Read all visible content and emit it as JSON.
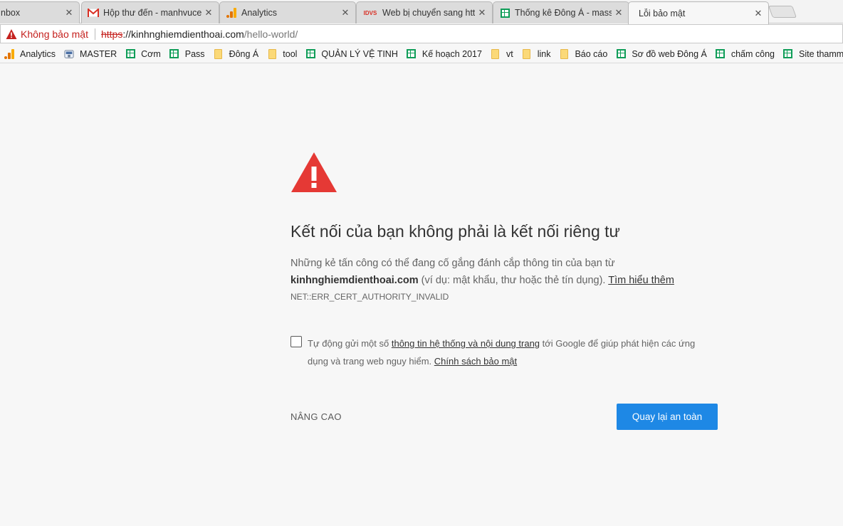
{
  "tabs": [
    {
      "title": "nbox",
      "icon": "inbox-icon",
      "close": "✕"
    },
    {
      "title": "Hộp thư đến - manhvuce",
      "icon": "gmail-icon",
      "close": "✕"
    },
    {
      "title": "Analytics",
      "icon": "analytics-icon",
      "close": "✕"
    },
    {
      "title": "Web bị chuyển sang http",
      "icon": "idvs-icon",
      "icon_text": "IDVS",
      "close": "✕"
    },
    {
      "title": "Thống kê Đông Á - mass",
      "icon": "sheets-icon",
      "close": "✕"
    },
    {
      "title": "Lỗi bảo mật",
      "icon": "none",
      "close": "✕"
    }
  ],
  "omnibox": {
    "security_label": "Không bảo mật",
    "url_scheme": "https",
    "url_host": "://kinhnghiemdienthoai.com",
    "url_path": "/hello-world/"
  },
  "bookmarks": [
    {
      "label": "Analytics",
      "icon": "analytics-icon"
    },
    {
      "label": "MASTER",
      "icon": "master-icon"
    },
    {
      "label": "Cơm",
      "icon": "sheets-icon"
    },
    {
      "label": "Pass",
      "icon": "sheets-icon"
    },
    {
      "label": "Đông Á",
      "icon": "folder-icon"
    },
    {
      "label": "tool",
      "icon": "folder-icon"
    },
    {
      "label": "QUẢN LÝ VỆ TINH",
      "icon": "sheets-icon"
    },
    {
      "label": "Kế hoạch 2017",
      "icon": "sheets-icon"
    },
    {
      "label": "vt",
      "icon": "folder-icon"
    },
    {
      "label": "link",
      "icon": "folder-icon"
    },
    {
      "label": "Báo cáo",
      "icon": "folder-icon"
    },
    {
      "label": "Sơ đồ web Đông Á",
      "icon": "sheets-icon"
    },
    {
      "label": "chấm công",
      "icon": "sheets-icon"
    },
    {
      "label": "Site thammyvi",
      "icon": "sheets-icon"
    }
  ],
  "interstitial": {
    "heading": "Kết nối của bạn không phải là kết nối riêng tư",
    "explain_1": "Những kẻ tấn công có thể đang cố gắng đánh cắp thông tin của bạn từ",
    "explain_host": "kinhnghiemdienthoai.com",
    "explain_2": " (ví dụ: mật khẩu, thư hoặc thẻ tín dụng). ",
    "learn_more": "Tìm hiểu thêm",
    "error_code": "NET::ERR_CERT_AUTHORITY_INVALID",
    "report_1": "Tự động gửi một số ",
    "report_link": "thông tin hệ thống và nội dung trang",
    "report_2": " tới Google để giúp phát hiện các ứng dụng và trang web nguy hiểm. ",
    "privacy_link": "Chính sách bảo mật",
    "advanced": "NÂNG CAO",
    "back_button": "Quay lại an toàn"
  },
  "colors": {
    "danger": "#c5221f",
    "warning_triangle": "#e53935",
    "primary_button": "#1e88e5"
  }
}
